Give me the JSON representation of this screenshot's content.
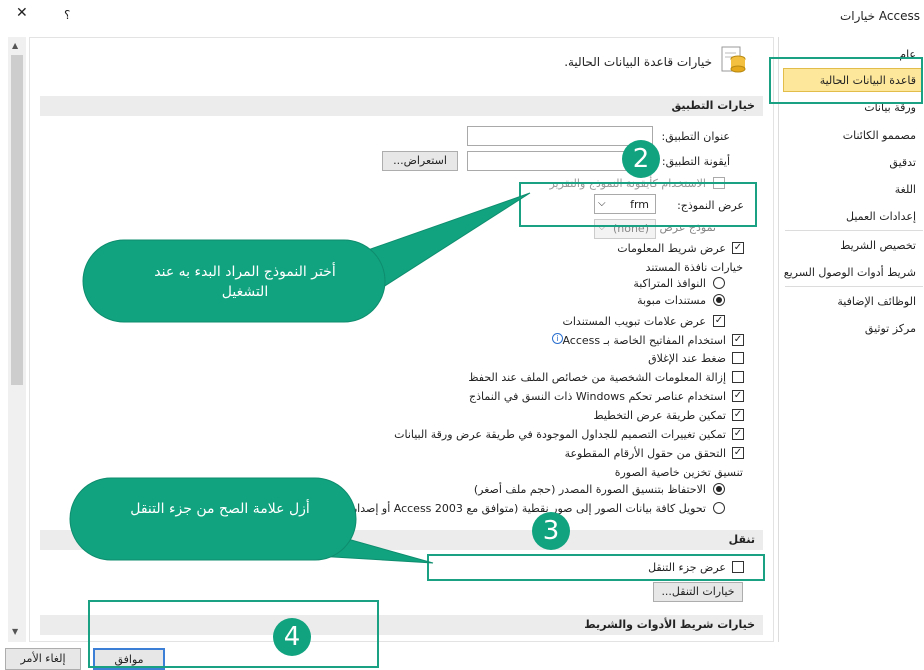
{
  "window": {
    "title": "خيارات Access",
    "help_glyph": "؟",
    "close_glyph": "✕"
  },
  "sidebar": {
    "items": [
      {
        "label": "عام"
      },
      {
        "label": "قاعدة البيانات الحالية",
        "selected": true
      },
      {
        "label": "ورقة بيانات"
      },
      {
        "label": "مصممو الكائنات"
      },
      {
        "label": "تدقيق"
      },
      {
        "label": "اللغة"
      },
      {
        "label": "إعدادات العميل"
      },
      {
        "label": "تخصيص الشريط"
      },
      {
        "label": "شريط أدوات الوصول السريع"
      },
      {
        "label": "الوظائف الإضافية"
      },
      {
        "label": "مركز توثيق"
      }
    ]
  },
  "header": {
    "title": "خيارات قاعدة البيانات الحالية."
  },
  "app_options": {
    "section_title": "خيارات التطبيق",
    "app_title_label": "عنوان التطبيق:",
    "app_title_value": "",
    "app_icon_label": "أيقونة التطبيق:",
    "app_icon_value": "",
    "browse_label": "استعراض...",
    "use_as_icon_label": "الاستخدام كأيقونة النموذج والتقرير",
    "display_form_label": "عرض النموذج:",
    "display_form_value": "frm",
    "web_form_label": "نموذج عرض ويب:",
    "web_form_value": "(none)",
    "status_bar_label": "عرض شريط المعلومات",
    "doc_window_label": "خيارات نافذة المستند",
    "overlapping_label": "النوافذ المتراكبة",
    "tabbed_label": "مستندات مبوبة",
    "doc_tabs_label": "عرض علامات تبويب المستندات",
    "special_keys_label": "استخدام المفاتيح الخاصة بـ Access",
    "compact_label": "ضغط عند الإغلاق",
    "remove_personal_label": "إزالة المعلومات الشخصية من خصائص الملف عند الحفظ",
    "windows_themed_label": "استخدام عناصر تحكم Windows ذات النسق في النماذج",
    "layout_view_label": "تمكين طريقة عرض التخطيط",
    "design_changes_label": "تمكين تغييرات التصميم للجداول الموجودة في طريقة عرض ورقة البيانات",
    "truncated_label": "التحقق من حقول الأرقام المقطوعة",
    "picture_format_label": "تنسيق تخزين خاصية الصورة",
    "preserve_label": "الاحتفاظ بتنسيق الصورة المصدر (حجم ملف أصغر)",
    "convert_label": "تحويل كافة بيانات الصور إلى صور نقطية (متوافق مع Access 2003 أو إصدار سابق)"
  },
  "navigation": {
    "section_title": "تنقل",
    "show_nav_label": "عرض جزء التنقل",
    "nav_options_label": "خيارات التنقل..."
  },
  "ribbon": {
    "section_title": "خيارات شريط الأدوات والشريط"
  },
  "callouts": {
    "c1": "أختر النموذج المراد البدء به عند التشغيل",
    "c2": "أزل علامة الصح من جزء التنقل",
    "n2": "2",
    "n3": "3",
    "n4": "4"
  },
  "footer": {
    "ok_label": "موافق",
    "cancel_label": "إلغاء الأمر"
  },
  "colors": {
    "accent": "#11a37f",
    "selected": "#fde79b"
  }
}
